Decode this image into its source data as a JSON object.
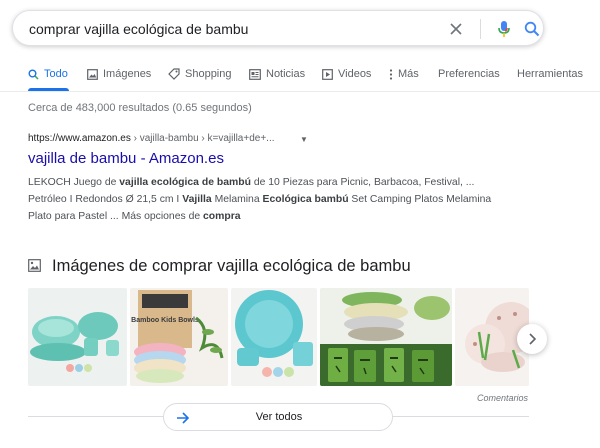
{
  "search": {
    "query": "comprar vajilla ecológica de bambu"
  },
  "tabs": [
    {
      "label": "Todo",
      "icon": "search-icon",
      "active": true
    },
    {
      "label": "Imágenes",
      "icon": "image-icon"
    },
    {
      "label": "Shopping",
      "icon": "tag-icon"
    },
    {
      "label": "Noticias",
      "icon": "news-icon"
    },
    {
      "label": "Videos",
      "icon": "play-icon"
    },
    {
      "label": "Más",
      "icon": "more-vertical-icon"
    },
    {
      "label": "Preferencias"
    },
    {
      "label": "Herramientas"
    }
  ],
  "stats": "Cerca de 483,000 resultados (0.65 segundos)",
  "result": {
    "site": "https://www.amazon.es",
    "path": " › vajilla-bambu › k=vajilla+de+...",
    "title": "vajilla de bambu - Amazon.es"
  },
  "images": {
    "heading": "Imágenes de comprar vajilla ecológica de bambu",
    "box_text": "Bamboo Kids Bowls",
    "feedback": "Comentarios",
    "view_all": "Ver todos"
  },
  "colors": {
    "link": "#1a0dab",
    "accent": "#1a73e8",
    "muted": "#70757a"
  }
}
